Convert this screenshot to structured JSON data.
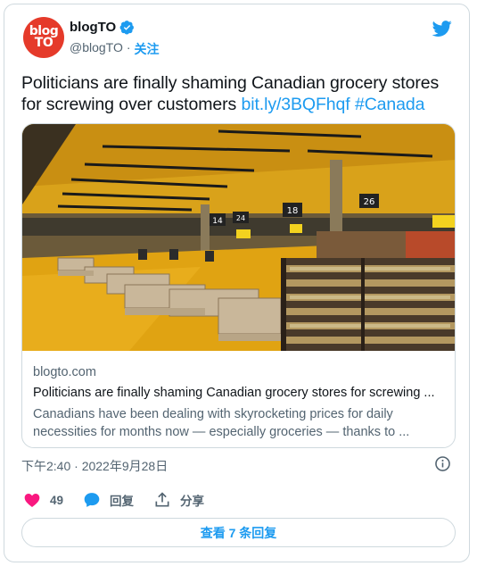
{
  "author": {
    "logo_line1": "blog",
    "logo_line2": "TO",
    "name": "blogTO",
    "handle": "@blogTO",
    "separator": "·",
    "follow_label": "关注"
  },
  "tweet": {
    "text": "Politicians are finally shaming Canadian grocery stores for screwing over customers",
    "link": "bit.ly/3BQFhqf",
    "hashtag": "#Canada"
  },
  "link_card": {
    "domain": "blogto.com",
    "title": "Politicians are finally shaming Canadian grocery stores for screwing ...",
    "description": "Canadians have been dealing with skyrocketing prices for daily necessities for months now — especially groceries — thanks to ...",
    "aisle_signs": [
      "14",
      "18",
      "26",
      "24"
    ]
  },
  "meta": {
    "timestamp": "下午2:40 · 2022年9月28日"
  },
  "actions": {
    "like_count": "49",
    "reply_label": "回复",
    "share_label": "分享"
  },
  "view_replies_label": "查看 7 条回复",
  "colors": {
    "accent": "#1d9bf0",
    "like": "#f91880",
    "logo": "#e53a2a"
  }
}
